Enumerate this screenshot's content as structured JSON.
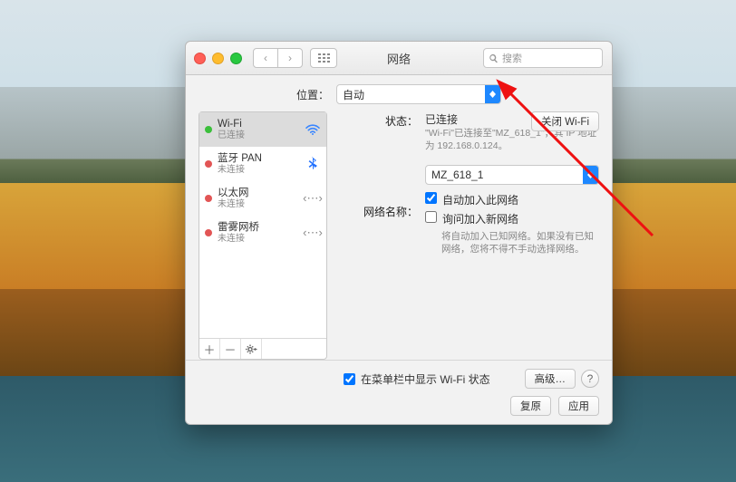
{
  "window": {
    "title": "网络",
    "search_placeholder": "搜索"
  },
  "location": {
    "label": "位置：",
    "value": "自动"
  },
  "services": [
    {
      "name": "Wi-Fi",
      "status": "已连接",
      "statusColor": "green",
      "icon": "wifi"
    },
    {
      "name": "蓝牙 PAN",
      "status": "未连接",
      "statusColor": "red",
      "icon": "bluetooth"
    },
    {
      "name": "以太网",
      "status": "未连接",
      "statusColor": "red",
      "icon": "ethernet"
    },
    {
      "name": "雷雾网桥",
      "status": "未连接",
      "statusColor": "red",
      "icon": "ethernet"
    }
  ],
  "detail": {
    "status_label": "状态：",
    "status_value": "已连接",
    "status_sub": "\"Wi-Fi\"已连接至\"MZ_618_1\"，其 IP 地址为 192.168.0.124。",
    "turn_off_label": "关闭 Wi-Fi",
    "network_name_label": "网络名称：",
    "network_name_value": "MZ_618_1",
    "auto_join_label": "自动加入此网络",
    "auto_join_checked": true,
    "ask_join_label": "询问加入新网络",
    "ask_join_checked": false,
    "ask_join_hint": "将自动加入已知网络。如果没有已知网络，您将不得不手动选择网络。"
  },
  "footer": {
    "show_status_label": "在菜单栏中显示 Wi-Fi 状态",
    "show_status_checked": true,
    "advanced_label": "高级…",
    "revert_label": "复原",
    "apply_label": "应用"
  }
}
